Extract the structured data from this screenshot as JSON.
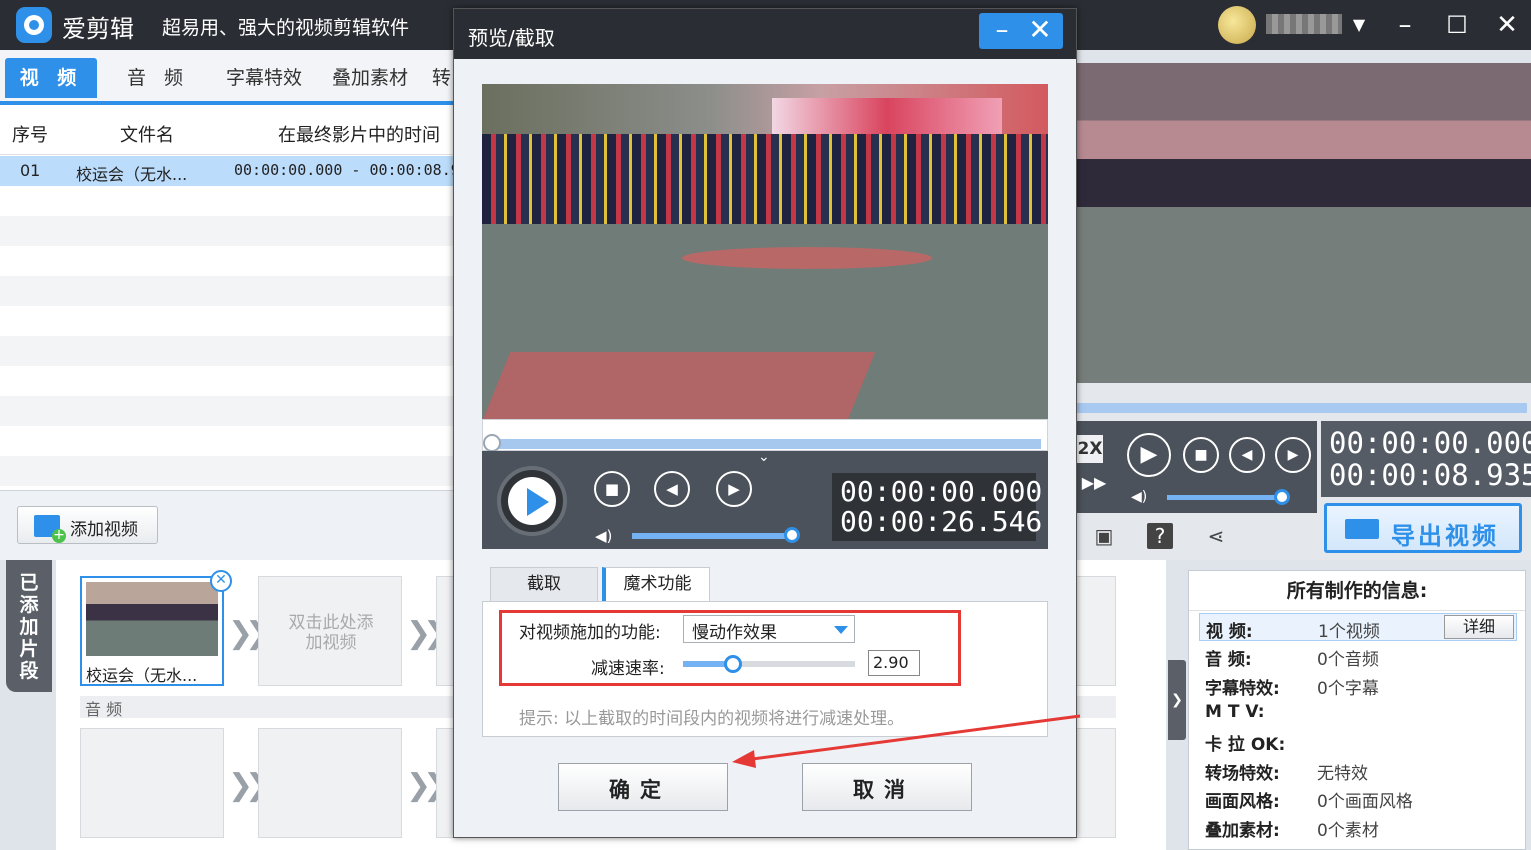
{
  "app": {
    "name": "爱剪辑",
    "slogan": "超易用、强大的视频剪辑软件",
    "window_controls": [
      "–",
      "☐",
      "✕"
    ]
  },
  "tabs": [
    "视 频",
    "音 频",
    "字幕特效",
    "叠加素材",
    "转"
  ],
  "list": {
    "headers": [
      "序号",
      "文件名",
      "在最终影片中的时间"
    ],
    "rows": [
      {
        "index": "01",
        "name": "校运会（无水...",
        "time": "00:00:00.000 - 00:00:08.9"
      }
    ]
  },
  "add_video_label": "添加视频",
  "timeline": {
    "added_tab": "已添加片段",
    "clip_label": "校运会（无水...",
    "placeholder": "双击此处添加视频",
    "audio_label": "音 频"
  },
  "right": {
    "speed": "2X",
    "time_current": "00:00:00.000",
    "time_total": "00:00:08.935",
    "export_label": "导出视频"
  },
  "info": {
    "title": "所有制作的信息:",
    "detail_label": "详细",
    "rows": [
      {
        "key": "视    频:",
        "value": "1个视频"
      },
      {
        "key": "音    频:",
        "value": "0个音频"
      },
      {
        "key": "字幕特效:",
        "value": "0个字幕"
      },
      {
        "key": "M  T  V:",
        "value": ""
      },
      {
        "key": "卡 拉 OK:",
        "value": ""
      },
      {
        "key": "转场特效:",
        "value": "无特效"
      },
      {
        "key": "画面风格:",
        "value": "0个画面风格"
      },
      {
        "key": "叠加素材:",
        "value": "0个素材"
      }
    ]
  },
  "dialog": {
    "title": "预览/截取",
    "time_current": "00:00:00.000",
    "time_total": "00:00:26.546",
    "tabs": [
      "截取",
      "魔术功能"
    ],
    "func_label": "对视频施加的功能:",
    "func_value": "慢动作效果",
    "rate_label": "减速速率:",
    "rate_value": "2.90",
    "rate_level": 0.29,
    "hint": "提示: 以上截取的时间段内的视频将进行减速处理。",
    "ok_label": "确定",
    "cancel_label": "取消"
  },
  "colors": {
    "accent": "#2e90e8",
    "titlebar": "#2a2d33",
    "annotation": "#e53935"
  }
}
